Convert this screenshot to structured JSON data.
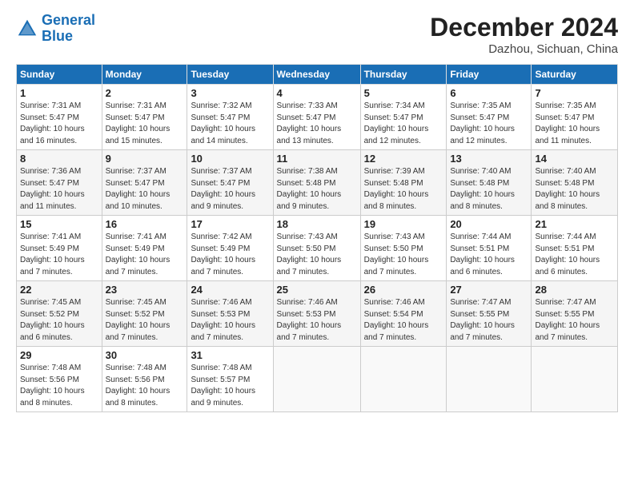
{
  "logo": {
    "line1": "General",
    "line2": "Blue"
  },
  "title": "December 2024",
  "subtitle": "Dazhou, Sichuan, China",
  "days_of_week": [
    "Sunday",
    "Monday",
    "Tuesday",
    "Wednesday",
    "Thursday",
    "Friday",
    "Saturday"
  ],
  "weeks": [
    [
      {
        "day": "1",
        "info": "Sunrise: 7:31 AM\nSunset: 5:47 PM\nDaylight: 10 hours\nand 16 minutes."
      },
      {
        "day": "2",
        "info": "Sunrise: 7:31 AM\nSunset: 5:47 PM\nDaylight: 10 hours\nand 15 minutes."
      },
      {
        "day": "3",
        "info": "Sunrise: 7:32 AM\nSunset: 5:47 PM\nDaylight: 10 hours\nand 14 minutes."
      },
      {
        "day": "4",
        "info": "Sunrise: 7:33 AM\nSunset: 5:47 PM\nDaylight: 10 hours\nand 13 minutes."
      },
      {
        "day": "5",
        "info": "Sunrise: 7:34 AM\nSunset: 5:47 PM\nDaylight: 10 hours\nand 12 minutes."
      },
      {
        "day": "6",
        "info": "Sunrise: 7:35 AM\nSunset: 5:47 PM\nDaylight: 10 hours\nand 12 minutes."
      },
      {
        "day": "7",
        "info": "Sunrise: 7:35 AM\nSunset: 5:47 PM\nDaylight: 10 hours\nand 11 minutes."
      }
    ],
    [
      {
        "day": "8",
        "info": "Sunrise: 7:36 AM\nSunset: 5:47 PM\nDaylight: 10 hours\nand 11 minutes."
      },
      {
        "day": "9",
        "info": "Sunrise: 7:37 AM\nSunset: 5:47 PM\nDaylight: 10 hours\nand 10 minutes."
      },
      {
        "day": "10",
        "info": "Sunrise: 7:37 AM\nSunset: 5:47 PM\nDaylight: 10 hours\nand 9 minutes."
      },
      {
        "day": "11",
        "info": "Sunrise: 7:38 AM\nSunset: 5:48 PM\nDaylight: 10 hours\nand 9 minutes."
      },
      {
        "day": "12",
        "info": "Sunrise: 7:39 AM\nSunset: 5:48 PM\nDaylight: 10 hours\nand 8 minutes."
      },
      {
        "day": "13",
        "info": "Sunrise: 7:40 AM\nSunset: 5:48 PM\nDaylight: 10 hours\nand 8 minutes."
      },
      {
        "day": "14",
        "info": "Sunrise: 7:40 AM\nSunset: 5:48 PM\nDaylight: 10 hours\nand 8 minutes."
      }
    ],
    [
      {
        "day": "15",
        "info": "Sunrise: 7:41 AM\nSunset: 5:49 PM\nDaylight: 10 hours\nand 7 minutes."
      },
      {
        "day": "16",
        "info": "Sunrise: 7:41 AM\nSunset: 5:49 PM\nDaylight: 10 hours\nand 7 minutes."
      },
      {
        "day": "17",
        "info": "Sunrise: 7:42 AM\nSunset: 5:49 PM\nDaylight: 10 hours\nand 7 minutes."
      },
      {
        "day": "18",
        "info": "Sunrise: 7:43 AM\nSunset: 5:50 PM\nDaylight: 10 hours\nand 7 minutes."
      },
      {
        "day": "19",
        "info": "Sunrise: 7:43 AM\nSunset: 5:50 PM\nDaylight: 10 hours\nand 7 minutes."
      },
      {
        "day": "20",
        "info": "Sunrise: 7:44 AM\nSunset: 5:51 PM\nDaylight: 10 hours\nand 6 minutes."
      },
      {
        "day": "21",
        "info": "Sunrise: 7:44 AM\nSunset: 5:51 PM\nDaylight: 10 hours\nand 6 minutes."
      }
    ],
    [
      {
        "day": "22",
        "info": "Sunrise: 7:45 AM\nSunset: 5:52 PM\nDaylight: 10 hours\nand 6 minutes."
      },
      {
        "day": "23",
        "info": "Sunrise: 7:45 AM\nSunset: 5:52 PM\nDaylight: 10 hours\nand 7 minutes."
      },
      {
        "day": "24",
        "info": "Sunrise: 7:46 AM\nSunset: 5:53 PM\nDaylight: 10 hours\nand 7 minutes."
      },
      {
        "day": "25",
        "info": "Sunrise: 7:46 AM\nSunset: 5:53 PM\nDaylight: 10 hours\nand 7 minutes."
      },
      {
        "day": "26",
        "info": "Sunrise: 7:46 AM\nSunset: 5:54 PM\nDaylight: 10 hours\nand 7 minutes."
      },
      {
        "day": "27",
        "info": "Sunrise: 7:47 AM\nSunset: 5:55 PM\nDaylight: 10 hours\nand 7 minutes."
      },
      {
        "day": "28",
        "info": "Sunrise: 7:47 AM\nSunset: 5:55 PM\nDaylight: 10 hours\nand 7 minutes."
      }
    ],
    [
      {
        "day": "29",
        "info": "Sunrise: 7:48 AM\nSunset: 5:56 PM\nDaylight: 10 hours\nand 8 minutes."
      },
      {
        "day": "30",
        "info": "Sunrise: 7:48 AM\nSunset: 5:56 PM\nDaylight: 10 hours\nand 8 minutes."
      },
      {
        "day": "31",
        "info": "Sunrise: 7:48 AM\nSunset: 5:57 PM\nDaylight: 10 hours\nand 9 minutes."
      },
      {
        "day": "",
        "info": ""
      },
      {
        "day": "",
        "info": ""
      },
      {
        "day": "",
        "info": ""
      },
      {
        "day": "",
        "info": ""
      }
    ]
  ]
}
